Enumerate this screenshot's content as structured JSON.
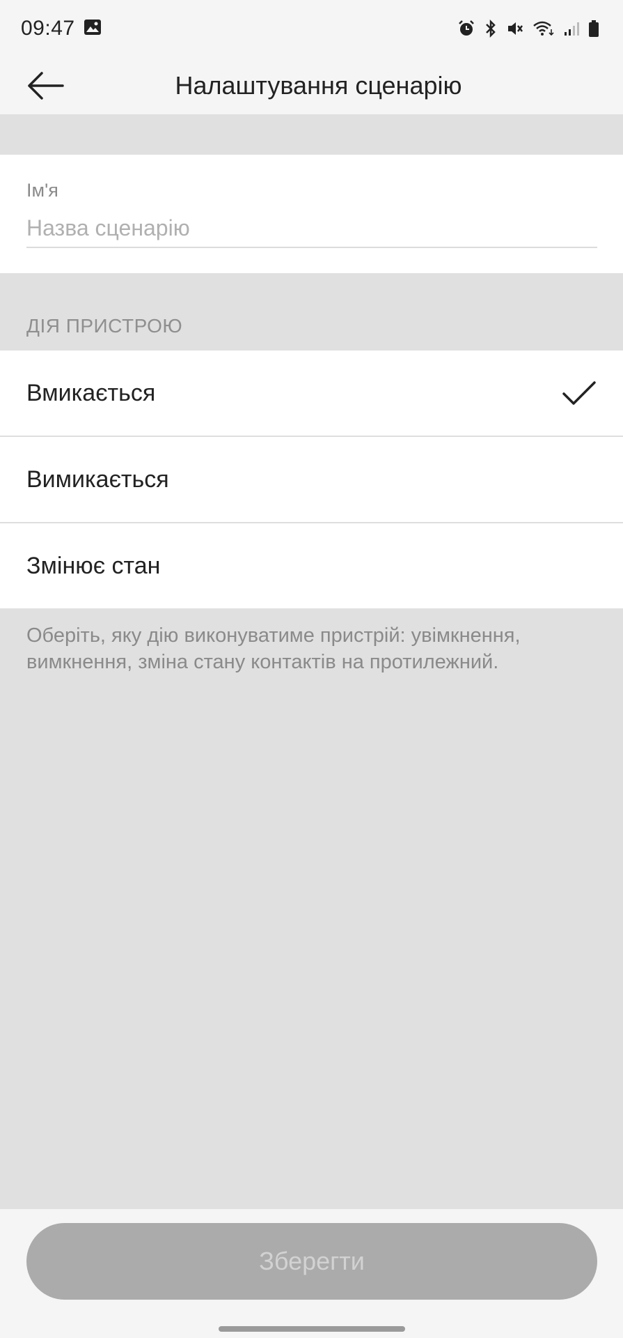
{
  "status_bar": {
    "time": "09:47",
    "icons": [
      "gallery-icon",
      "alarm-icon",
      "bluetooth-icon",
      "mute-icon",
      "wifi-icon",
      "signal-icon",
      "battery-icon"
    ]
  },
  "header": {
    "title": "Налаштування сценарію",
    "back_icon": "arrow-left-icon"
  },
  "name_field": {
    "label": "Ім'я",
    "placeholder": "Назва сценарію",
    "value": ""
  },
  "device_action": {
    "section_title": "ДІЯ ПРИСТРОЮ",
    "options": [
      {
        "label": "Вмикається",
        "selected": true
      },
      {
        "label": "Вимикається",
        "selected": false
      },
      {
        "label": "Змінює стан",
        "selected": false
      }
    ],
    "description": "Оберіть, яку дію виконуватиме пристрій: увімкнення, вимкнення, зміна стану контактів на протилежний."
  },
  "footer": {
    "save_label": "Зберегти"
  },
  "colors": {
    "background": "#e0e0e0",
    "surface": "#ffffff",
    "bar": "#f5f5f5",
    "button_disabled": "#ababab",
    "button_text_disabled": "#d2d2d2"
  }
}
